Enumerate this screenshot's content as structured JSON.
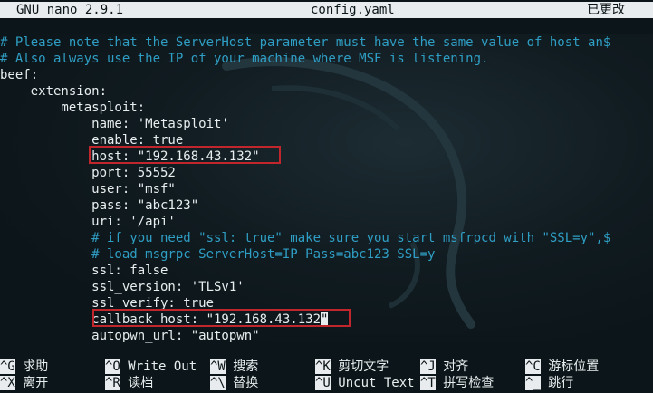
{
  "title_bar": {
    "app": "GNU nano 2.9.1",
    "filename": "config.yaml",
    "status": "已更改"
  },
  "editor": {
    "lines": [
      {
        "text": "# Please note that the ServerHost parameter must have the same value of host an$",
        "type": "comment"
      },
      {
        "text": "# Also always use the IP of your machine where MSF is listening.",
        "type": "comment"
      },
      {
        "text": "beef:",
        "type": "code"
      },
      {
        "text": "    extension:",
        "type": "code"
      },
      {
        "text": "        metasploit:",
        "type": "code"
      },
      {
        "text": "            name: 'Metasploit'",
        "type": "code"
      },
      {
        "text": "            enable: true",
        "type": "code"
      },
      {
        "text": "            host: \"192.168.43.132\"",
        "type": "code"
      },
      {
        "text": "            port: 55552",
        "type": "code"
      },
      {
        "text": "            user: \"msf\"",
        "type": "code"
      },
      {
        "text": "            pass: \"abc123\"",
        "type": "code"
      },
      {
        "text": "            uri: '/api'",
        "type": "code"
      },
      {
        "text": "            # if you need \"ssl: true\" make sure you start msfrpcd with \"SSL=y\",$",
        "type": "comment"
      },
      {
        "text": "            # load msgrpc ServerHost=IP Pass=abc123 SSL=y",
        "type": "comment"
      },
      {
        "text": "            ssl: false",
        "type": "code"
      },
      {
        "text": "            ssl_version: 'TLSv1'",
        "type": "code"
      },
      {
        "text": "            ssl_verify: true",
        "type": "code"
      },
      {
        "text": "            callback_host: \"192.168.43.132",
        "type": "code",
        "cursor_char": "\""
      },
      {
        "text": "            autopwn_url: \"autopwn\"",
        "type": "code"
      }
    ]
  },
  "shortcuts": [
    {
      "key": "^G",
      "label": "求助"
    },
    {
      "key": "^O",
      "label": "Write Out"
    },
    {
      "key": "^W",
      "label": "搜索"
    },
    {
      "key": "^K",
      "label": "剪切文字"
    },
    {
      "key": "^J",
      "label": "对齐"
    },
    {
      "key": "^C",
      "label": "游标位置"
    },
    {
      "key": "^X",
      "label": "离开"
    },
    {
      "key": "^R",
      "label": "读档"
    },
    {
      "key": "^\\",
      "label": "替换"
    },
    {
      "key": "^U",
      "label": "Uncut Text"
    },
    {
      "key": "^T",
      "label": "拼写检查"
    },
    {
      "key": "^_",
      "label": "跳行"
    }
  ],
  "colors": {
    "background": "#0c1519",
    "comment": "#2f9ec4",
    "text": "#e8eef0",
    "highlight_box": "#c0262b",
    "bar": "#e8ecee"
  }
}
